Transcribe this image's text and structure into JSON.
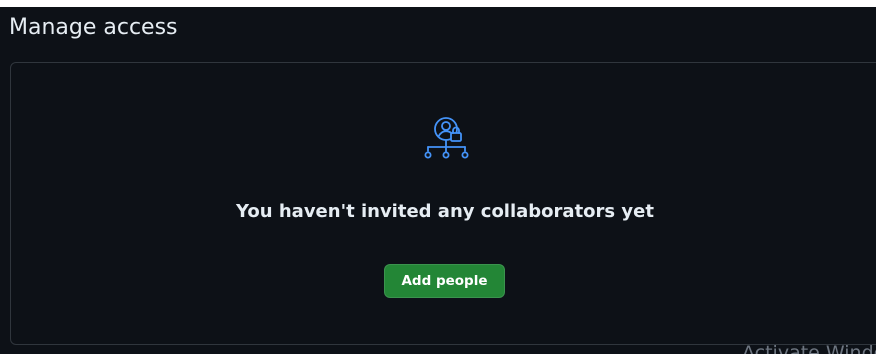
{
  "page": {
    "title": "Manage access"
  },
  "blankslate": {
    "icon": "person-lock-hierarchy-icon",
    "heading": "You haven't invited any collaborators yet",
    "button_label": "Add people"
  },
  "watermark": {
    "text": "Activate Windows"
  },
  "colors": {
    "background": "#0d1117",
    "border": "#30363d",
    "text": "#e6edf3",
    "accent_icon": "#4493f8",
    "primary_button": "#238636"
  }
}
